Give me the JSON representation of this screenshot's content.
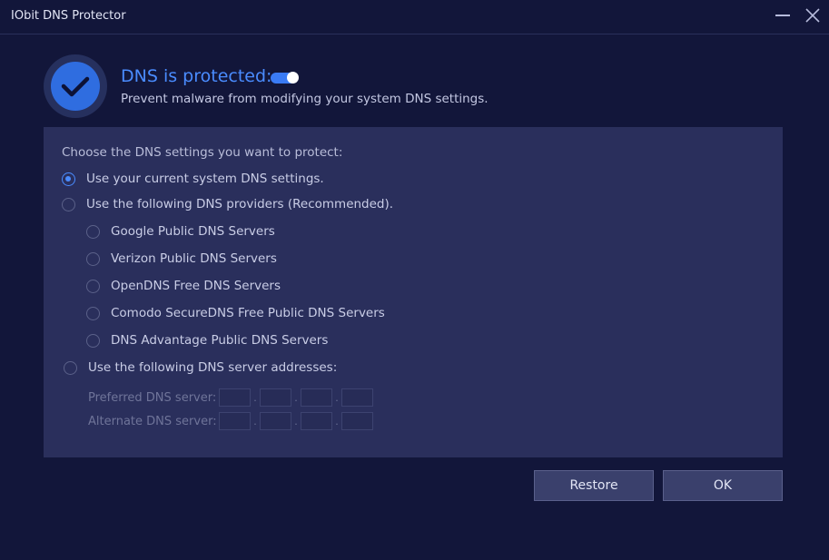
{
  "window": {
    "title": "IObit DNS Protector"
  },
  "status": {
    "headline": "DNS is protected:",
    "description": "Prevent malware from modifying your system DNS settings.",
    "toggle_on": true
  },
  "settings": {
    "prompt": "Choose the DNS settings you want to protect:",
    "options": [
      {
        "label": "Use your current system DNS settings.",
        "checked": true
      },
      {
        "label": "Use the following DNS providers (Recommended).",
        "checked": false
      },
      {
        "label": "Use the following DNS server addresses:",
        "checked": false
      }
    ],
    "providers": [
      {
        "label": "Google Public DNS Servers",
        "checked": false
      },
      {
        "label": "Verizon Public DNS Servers",
        "checked": false
      },
      {
        "label": "OpenDNS Free DNS Servers",
        "checked": false
      },
      {
        "label": "Comodo SecureDNS Free Public DNS Servers",
        "checked": false
      },
      {
        "label": "DNS Advantage Public DNS Servers",
        "checked": false
      }
    ],
    "preferred_label": "Preferred DNS server:",
    "alternate_label": "Alternate DNS server:",
    "ip_separator": "."
  },
  "buttons": {
    "restore": "Restore",
    "ok": "OK"
  },
  "colors": {
    "background": "#12163a",
    "panel": "#2a2f5c",
    "accent": "#4a8cff"
  }
}
